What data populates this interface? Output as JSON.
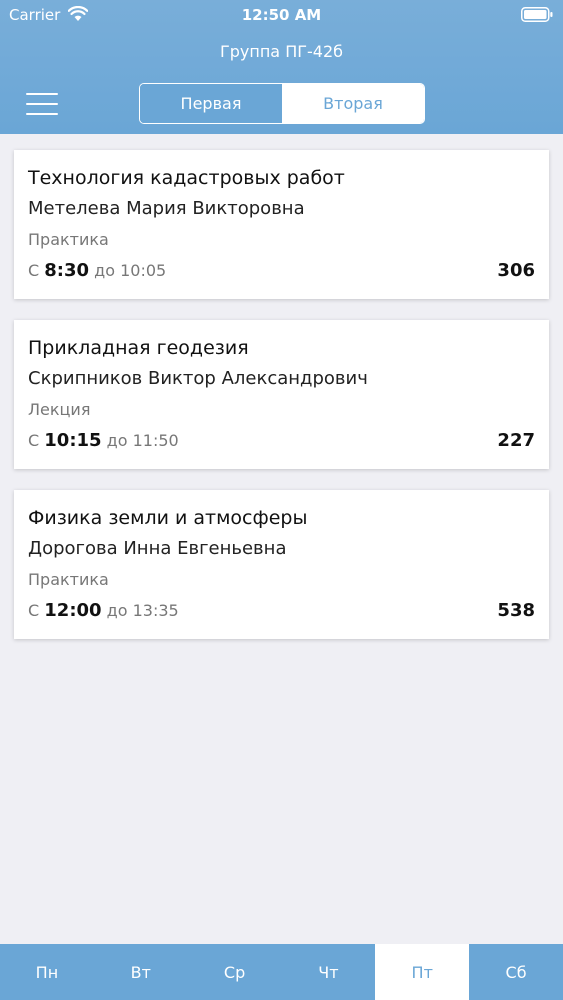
{
  "status_bar": {
    "carrier": "Carrier",
    "time": "12:50 AM"
  },
  "header": {
    "title": "Группа ПГ-42б",
    "segments": [
      {
        "label": "Первая",
        "active": true
      },
      {
        "label": "Вторая",
        "active": false
      }
    ]
  },
  "lessons": [
    {
      "subject": "Технология кадастровых работ",
      "teacher": "Метелева Мария Викторовна",
      "type": "Практика",
      "from_label": "С",
      "start": "8:30",
      "to_label": "до",
      "end": "10:05",
      "room": "306"
    },
    {
      "subject": "Прикладная геодезия",
      "teacher": "Скрипников Виктор Александрович",
      "type": "Лекция",
      "from_label": "С",
      "start": "10:15",
      "to_label": "до",
      "end": "11:50",
      "room": "227"
    },
    {
      "subject": "Физика земли и атмосферы",
      "teacher": "Дорогова Инна Евгеньевна",
      "type": "Практика",
      "from_label": "С",
      "start": "12:00",
      "to_label": "до",
      "end": "13:35",
      "room": "538"
    }
  ],
  "days": [
    {
      "label": "Пн",
      "active": false
    },
    {
      "label": "Вт",
      "active": false
    },
    {
      "label": "Ср",
      "active": false
    },
    {
      "label": "Чт",
      "active": false
    },
    {
      "label": "Пт",
      "active": true
    },
    {
      "label": "Сб",
      "active": false
    }
  ],
  "colors": {
    "accent": "#6aa6d6",
    "background": "#efeff4"
  }
}
